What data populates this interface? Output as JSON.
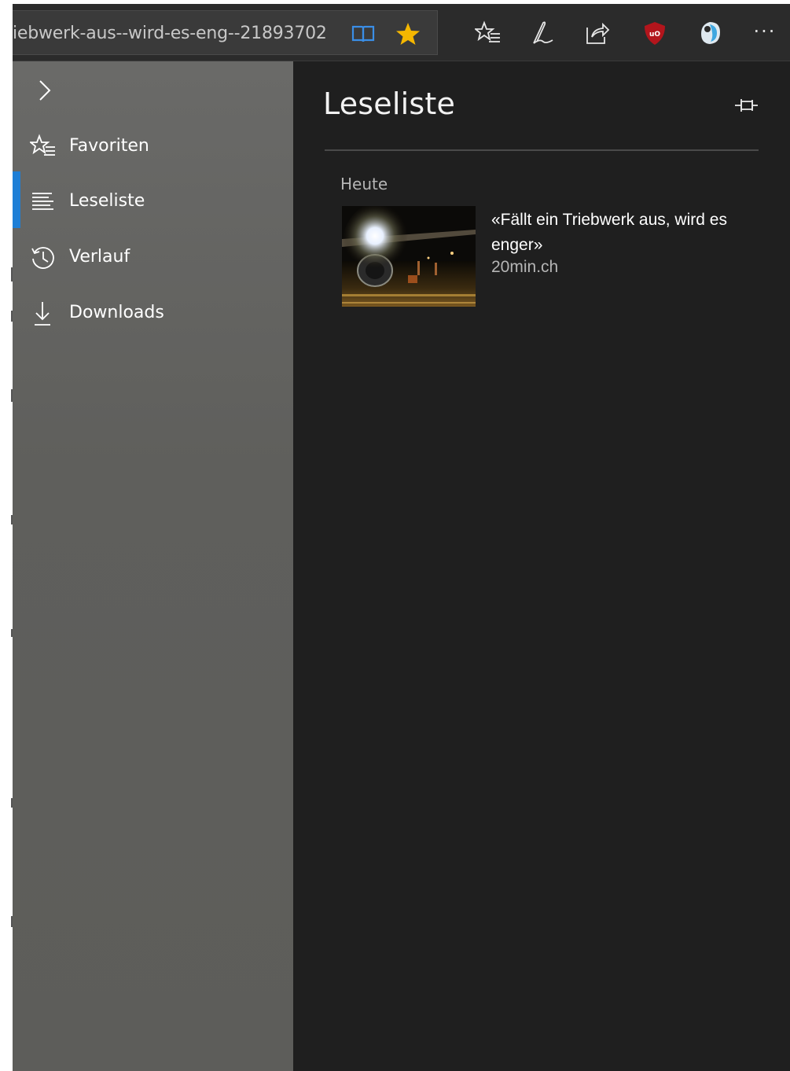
{
  "toolbar": {
    "url": "iebwerk-aus--wird-es-eng--21893702",
    "icons": [
      "reading-view-icon",
      "favorite-star-icon",
      "hub-icon",
      "notes-pen-icon",
      "share-icon",
      "ublock-icon",
      "extension-icon",
      "more-icon"
    ],
    "more_label": "···",
    "colors": {
      "star": "#f5b700",
      "reading_view": "#3a8ee6",
      "ublock": "#b3151c"
    }
  },
  "nav": {
    "collapse_icon": "chevron-right-icon",
    "items": [
      {
        "label": "Favoriten",
        "icon": "favorites-star-list-icon"
      },
      {
        "label": "Leseliste",
        "icon": "reading-list-icon",
        "active": true
      },
      {
        "label": "Verlauf",
        "icon": "history-clock-icon"
      },
      {
        "label": "Downloads",
        "icon": "download-arrow-icon"
      }
    ],
    "accent": "#1e7fd6"
  },
  "content": {
    "title": "Leseliste",
    "pin_icon": "pin-icon",
    "section": "Heute",
    "items": [
      {
        "title": "«Fällt ein Triebwerk aus, wird es enger»",
        "source": "20min.ch",
        "thumbnail": "airplane-at-night-image"
      }
    ]
  }
}
